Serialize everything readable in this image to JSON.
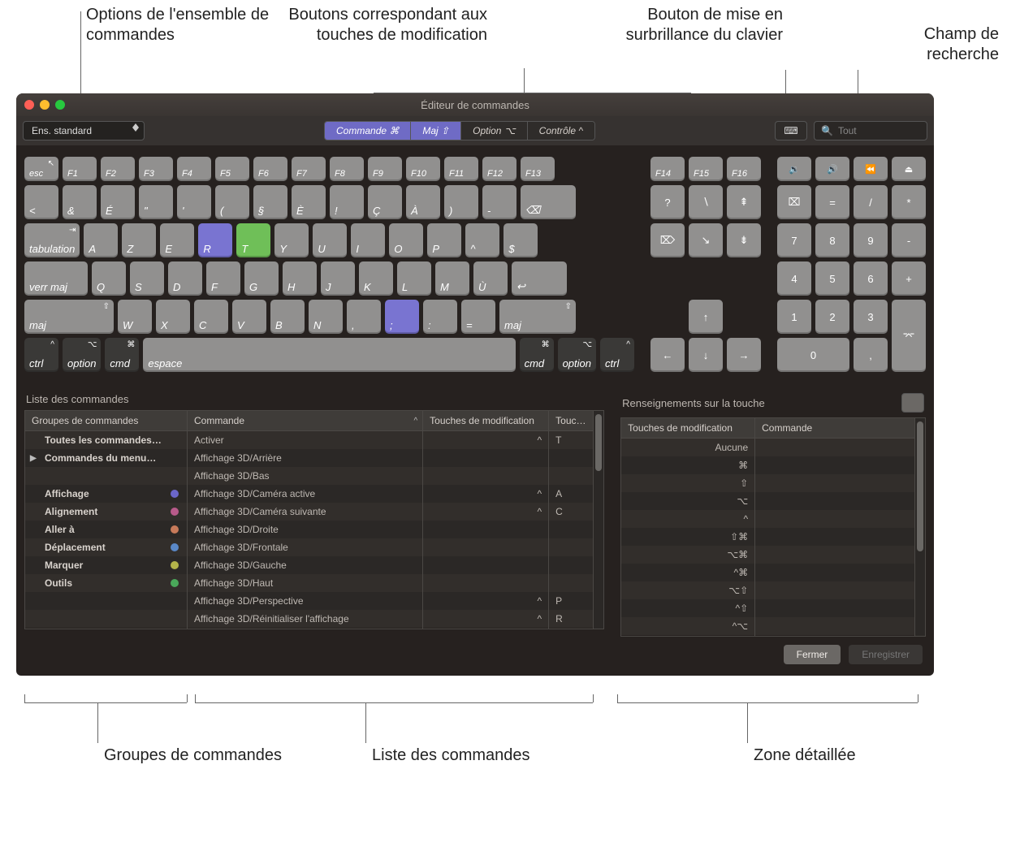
{
  "callouts": {
    "command_set": "Options de l'ensemble de commandes",
    "modifier_buttons": "Boutons correspondant aux touches de modification",
    "highlight": "Bouton de mise en surbrillance du clavier",
    "search": "Champ de recherche",
    "groups_bottom": "Groupes de commandes",
    "list_bottom": "Liste des commandes",
    "detail_bottom": "Zone détaillée"
  },
  "window_title": "Éditeur de commandes",
  "command_set_popup": "Ens. standard",
  "modifier_segments": {
    "command": "Commande ⌘",
    "shift": "Maj ⇧",
    "option": "Option ⌥",
    "control": "Contrôle ^"
  },
  "search_placeholder": "Tout",
  "list_title": "Liste des commandes",
  "detail_title": "Renseignements sur la touche",
  "headers": {
    "groups": "Groupes de commandes",
    "command": "Commande",
    "modifiers": "Touches de modification",
    "key": "Touche",
    "detail_mod": "Touches de modification",
    "detail_cmd": "Commande"
  },
  "groups": {
    "all": "Toutes les commandes…",
    "main_menu": "Commandes du menu…",
    "view": "Affichage",
    "alignment": "Alignement",
    "goto": "Aller à",
    "move": "Déplacement",
    "mark": "Marquer",
    "tools": "Outils"
  },
  "group_colors": {
    "view": "#6b66c9",
    "alignment": "#b85a8a",
    "goto": "#c77a5a",
    "move": "#5a88c7",
    "mark": "#b3b34a",
    "tools": "#4aa85a"
  },
  "commands": [
    {
      "name": "Activer",
      "mod": "^",
      "key": "T"
    },
    {
      "name": "Affichage 3D/Arrière",
      "mod": "",
      "key": ""
    },
    {
      "name": "Affichage 3D/Bas",
      "mod": "",
      "key": ""
    },
    {
      "name": "Affichage 3D/Caméra active",
      "mod": "^",
      "key": "A"
    },
    {
      "name": "Affichage 3D/Caméra suivante",
      "mod": "^",
      "key": "C"
    },
    {
      "name": "Affichage 3D/Droite",
      "mod": "",
      "key": ""
    },
    {
      "name": "Affichage 3D/Frontale",
      "mod": "",
      "key": ""
    },
    {
      "name": "Affichage 3D/Gauche",
      "mod": "",
      "key": ""
    },
    {
      "name": "Affichage 3D/Haut",
      "mod": "",
      "key": ""
    },
    {
      "name": "Affichage 3D/Perspective",
      "mod": "^",
      "key": "P"
    },
    {
      "name": "Affichage 3D/Réinitialiser l'affichage",
      "mod": "^",
      "key": "R"
    }
  ],
  "detail_rows": [
    {
      "mod": "Aucune",
      "cmd": ""
    },
    {
      "mod": "⌘",
      "cmd": ""
    },
    {
      "mod": "⇧",
      "cmd": ""
    },
    {
      "mod": "⌥",
      "cmd": ""
    },
    {
      "mod": "^",
      "cmd": ""
    },
    {
      "mod": "⇧⌘",
      "cmd": ""
    },
    {
      "mod": "⌥⌘",
      "cmd": ""
    },
    {
      "mod": "^⌘",
      "cmd": ""
    },
    {
      "mod": "⌥⇧",
      "cmd": ""
    },
    {
      "mod": "^⇧",
      "cmd": ""
    },
    {
      "mod": "^⌥",
      "cmd": ""
    }
  ],
  "buttons": {
    "close": "Fermer",
    "save": "Enregistrer"
  },
  "keys": {
    "esc": "esc",
    "tab": "tabulation",
    "caps": "verr maj",
    "shift": "maj",
    "ctrl": "ctrl",
    "option": "option",
    "cmd": "cmd",
    "space": "espace",
    "fn": [
      "F1",
      "F2",
      "F3",
      "F4",
      "F5",
      "F6",
      "F7",
      "F8",
      "F9",
      "F10",
      "F11",
      "F12",
      "F13"
    ],
    "fn2": [
      "F14",
      "F15",
      "F16"
    ],
    "num_row": [
      "<",
      "&",
      "É",
      "\"",
      "'",
      "(",
      "§",
      "È",
      "!",
      "Ç",
      "À",
      ")",
      "-",
      "⌫"
    ],
    "qwerty": [
      "A",
      "Z",
      "E",
      "R",
      "T",
      "Y",
      "U",
      "I",
      "O",
      "P",
      "^",
      "$"
    ],
    "asdf": [
      "Q",
      "S",
      "D",
      "F",
      "G",
      "H",
      "J",
      "K",
      "L",
      "M",
      "Ù",
      "↩"
    ],
    "zxcv": [
      "W",
      "X",
      "C",
      "V",
      "B",
      "N",
      ",",
      ";",
      ":",
      "="
    ],
    "side_top": [
      "?",
      "∖",
      "⇞"
    ],
    "side_mid": [
      "⌦",
      "↘",
      "⇟"
    ],
    "numpad": [
      [
        "⌧",
        "=",
        "/",
        "*"
      ],
      [
        "7",
        "8",
        "9",
        "-"
      ],
      [
        "4",
        "5",
        "6",
        "+"
      ],
      [
        "1",
        "2",
        "3"
      ],
      [
        "0",
        ","
      ]
    ],
    "media": [
      "🔉",
      "🔊",
      "⏪",
      "⏏"
    ]
  }
}
